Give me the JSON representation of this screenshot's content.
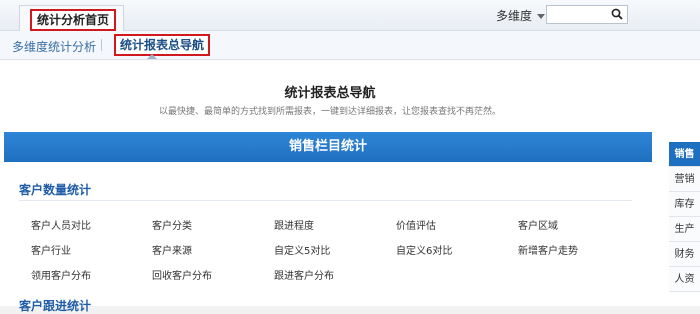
{
  "topbar": {
    "home_tab": "统计分析首页",
    "dimension_select": "多维度",
    "search_placeholder": ""
  },
  "subnav": {
    "items": [
      "多维度统计分析",
      "统计报表总导航"
    ],
    "active_index": 1
  },
  "main": {
    "title": "统计报表总导航",
    "subtitle": "以最快捷、最简单的方式找到所需报表，一键到达详细报表，让您报表查找不再茫然。",
    "section_title": "销售栏目统计",
    "categories": [
      {
        "title": "客户数量统计",
        "links": [
          "客户人员对比",
          "客户分类",
          "跟进程度",
          "价值评估",
          "客户区域",
          "客户行业",
          "客户来源",
          "自定义5对比",
          "自定义6对比",
          "新增客户走势",
          "领用客户分布",
          "回收客户分布",
          "跟进客户分布"
        ]
      },
      {
        "title": "客户跟进统计",
        "links": []
      }
    ]
  },
  "side_tabs": [
    "销售",
    "营销",
    "库存",
    "生产",
    "财务",
    "人资"
  ],
  "colors": {
    "accent": "#1f6fc0",
    "highlight_border": "#d0191f",
    "link_blue": "#3a6ea5"
  }
}
